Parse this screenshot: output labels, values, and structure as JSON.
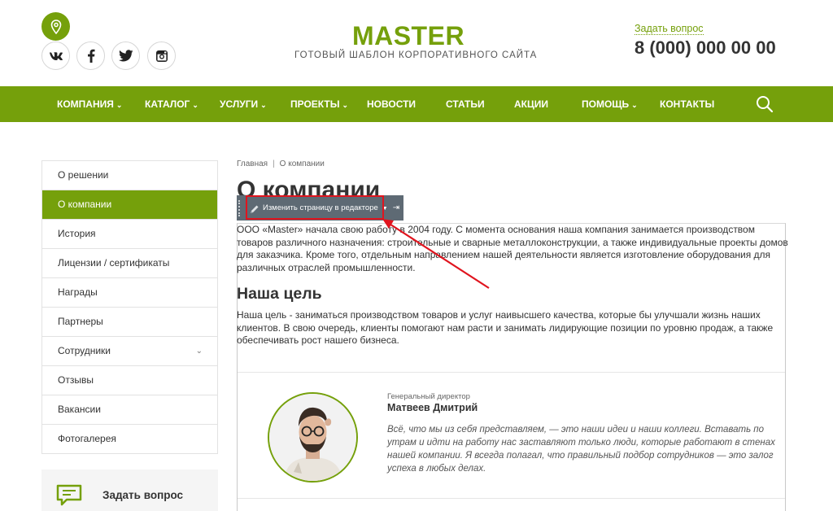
{
  "header": {
    "logo_title": "MASTER",
    "logo_subtitle": "ГОТОВЫЙ ШАБЛОН КОРПОРАТИВНОГО САЙТА",
    "ask_link": "Задать вопрос",
    "phone": "8 (000) 000 00 00",
    "social_icons": [
      "vk-icon",
      "facebook-icon",
      "twitter-icon",
      "instagram-icon"
    ]
  },
  "nav": {
    "items": [
      {
        "label": "КОМПАНИЯ",
        "has_dropdown": true
      },
      {
        "label": "КАТАЛОГ",
        "has_dropdown": true
      },
      {
        "label": "УСЛУГИ",
        "has_dropdown": true
      },
      {
        "label": "ПРОЕКТЫ",
        "has_dropdown": true
      },
      {
        "label": "НОВОСТИ",
        "has_dropdown": false
      },
      {
        "label": "СТАТЬИ",
        "has_dropdown": false
      },
      {
        "label": "АКЦИИ",
        "has_dropdown": false
      },
      {
        "label": "ПОМОЩЬ",
        "has_dropdown": true
      },
      {
        "label": "КОНТАКТЫ",
        "has_dropdown": false
      }
    ]
  },
  "sidebar": {
    "items": [
      {
        "label": "О решении"
      },
      {
        "label": "О компании",
        "active": true
      },
      {
        "label": "История"
      },
      {
        "label": "Лицензии / сертификаты"
      },
      {
        "label": "Награды"
      },
      {
        "label": "Партнеры"
      },
      {
        "label": "Сотрудники",
        "has_dropdown": true
      },
      {
        "label": "Отзывы"
      },
      {
        "label": "Вакансии"
      },
      {
        "label": "Фотогалерея"
      }
    ],
    "ask_box_label": "Задать вопрос"
  },
  "breadcrumb": {
    "home": "Главная",
    "separator": "|",
    "current": "О компании"
  },
  "page": {
    "title": "О компании",
    "intro": "ООО «Master» начала свою работу в 2004 году. С момента основания наша компания занимается производством товаров различного назначения: строительные и сварные металлоконструкции, а также индивидуальные проекты домов для заказчика. Кроме того, отдельным направлением нашей деятельности является изготовление оборудования для различных отраслей промышленности.",
    "goal_title": "Наша цель",
    "goal_text": "Наша цель - заниматься производством товаров и услуг наивысшего качества, которые бы улучшали жизнь наших клиентов. В свою очередь, клиенты помогают нам расти и занимать лидирующие позиции по уровню продаж, а также обеспечивать рост нашего бизнеса."
  },
  "editor": {
    "edit_button": "Изменить страницу в редакторе",
    "pin_glyph": "⇥"
  },
  "person": {
    "role": "Генеральный директор",
    "name": "Матвеев Дмитрий",
    "quote": "Всё, что мы из себя представляем, — это наши идеи и наши коллеги. Вставать по утрам и идти на работу нас заставляют только люди, которые работают в стенах нашей компании. Я всегда полагал, что правильный подбор сотрудников — это залог успеха в любых делах."
  },
  "colors": {
    "brand": "#75a00b",
    "editor_bar": "#5e6a74",
    "highlight": "#e0141e"
  }
}
